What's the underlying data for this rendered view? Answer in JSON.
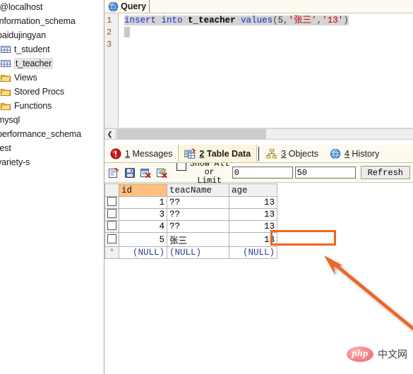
{
  "sidebar": {
    "items": [
      {
        "label": "t@localhost",
        "icon": "none",
        "indent": 0,
        "selected": false
      },
      {
        "label": "information_schema",
        "icon": "none",
        "indent": 0,
        "selected": false
      },
      {
        "label": "baidujingyan",
        "icon": "none",
        "indent": 0,
        "selected": false
      },
      {
        "label": "t_student",
        "icon": "table-icon",
        "indent": 1,
        "selected": false
      },
      {
        "label": "t_teacher",
        "icon": "table-icon",
        "indent": 1,
        "selected": true
      },
      {
        "label": "Views",
        "icon": "folder-icon",
        "indent": 1,
        "selected": false
      },
      {
        "label": "Stored Procs",
        "icon": "folder-icon",
        "indent": 1,
        "selected": false
      },
      {
        "label": "Functions",
        "icon": "folder-icon",
        "indent": 1,
        "selected": false
      },
      {
        "label": "mysql",
        "icon": "none",
        "indent": 0,
        "selected": false
      },
      {
        "label": "performance_schema",
        "icon": "none",
        "indent": 0,
        "selected": false
      },
      {
        "label": "test",
        "icon": "none",
        "indent": 0,
        "selected": false
      },
      {
        "label": "variety-s",
        "icon": "none",
        "indent": 0,
        "selected": false
      }
    ]
  },
  "query_tab": {
    "label": "Query",
    "icon": "query-globe-icon"
  },
  "editor": {
    "line_numbers": [
      "1",
      "2",
      "3"
    ],
    "sql_tokens": {
      "insert": "insert",
      "into": "into",
      "table": "t_teacher",
      "values": "values",
      "open_paren": "(",
      "id": "5",
      "comma1": ",",
      "name": "'张三'",
      "comma2": ",",
      "age": "'13'",
      "close_paren": ")"
    },
    "full_statement": "insert into t_teacher values(5,'张三','13')"
  },
  "result_tabs": [
    {
      "num": "1",
      "label": "Messages",
      "icon": "info-error-icon",
      "active": false
    },
    {
      "num": "2",
      "label": "Table Data",
      "icon": "table-data-icon",
      "active": true
    },
    {
      "num": "3",
      "label": "Objects",
      "icon": "objects-tree-icon",
      "active": false
    },
    {
      "num": "4",
      "label": "History",
      "icon": "history-globe-icon",
      "active": false
    }
  ],
  "grid_toolbar": {
    "buttons": [
      {
        "name": "new-record-icon"
      },
      {
        "name": "save-record-icon"
      },
      {
        "name": "delete-record-icon"
      },
      {
        "name": "cancel-edit-icon"
      }
    ],
    "show_all_label_line1": "Show All or",
    "show_all_label_line2": "Limit",
    "show_all_checked": false,
    "offset_value": "0",
    "limit_value": "50",
    "refresh_label": "Refresh"
  },
  "grid": {
    "columns": [
      "id",
      "teacName",
      "age"
    ],
    "highlighted_column": "id",
    "rows": [
      {
        "id": "1",
        "teacName": "??",
        "age": "13",
        "active_cell": "id"
      },
      {
        "id": "3",
        "teacName": "??",
        "age": "13",
        "active_cell": ""
      },
      {
        "id": "4",
        "teacName": "??",
        "age": "13",
        "active_cell": ""
      },
      {
        "id": "5",
        "teacName": "张三",
        "age": "13",
        "active_cell": ""
      }
    ],
    "new_row": {
      "marker": "*",
      "id": "(NULL)",
      "teacName": "(NULL)",
      "age": "(NULL)"
    }
  },
  "annotations": {
    "highlight_rect_target": "张三",
    "arrow_color": "#ee6622",
    "rect_color": "#ee6622"
  },
  "watermark": {
    "logo_text": "php",
    "text": "中文网",
    "logo_color": "#ef6d6d"
  }
}
